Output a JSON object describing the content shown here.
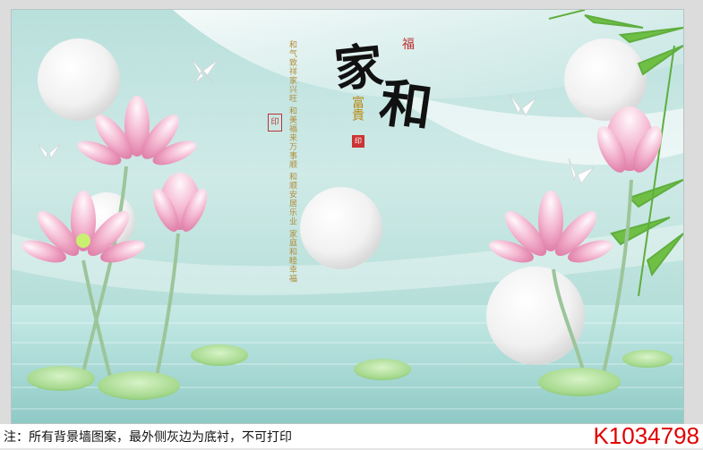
{
  "artwork": {
    "calligraphy_main_1": "家",
    "calligraphy_main_2": "和",
    "small_char_top": "福",
    "small_vertical": "富貴",
    "poem_lines": "和气致祥家兴旺 和美福来万事顺 和顺安居乐业 家庭和睦幸福",
    "seal_text": "印",
    "seal2_text": "印"
  },
  "footer": {
    "note": "注：所有背景墙图案，最外侧灰边为底衬，不可打印",
    "code": "K1034798"
  },
  "colors": {
    "code_red": "#e00000",
    "bg_teal": "#bfe3de",
    "lotus_pink": "#f1a8c7"
  }
}
